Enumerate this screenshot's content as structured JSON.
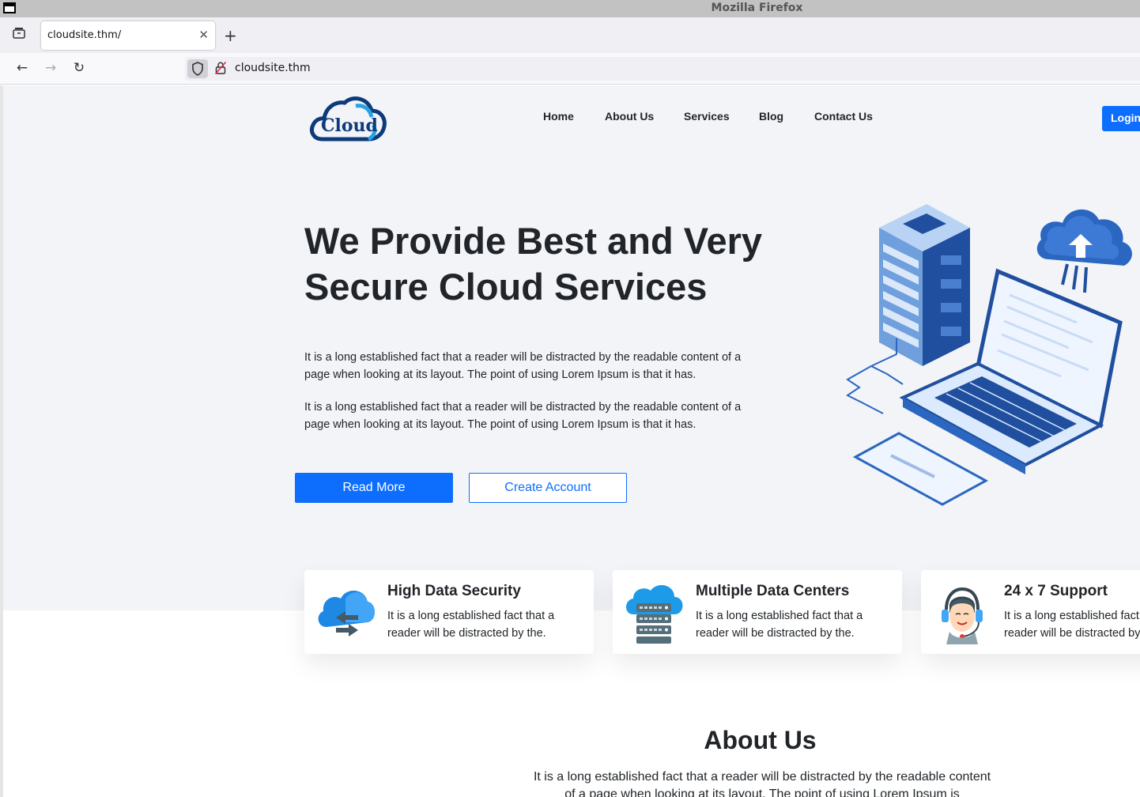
{
  "browser": {
    "window_title": "Mozilla Firefox",
    "tab_title": "cloudsite.thm/",
    "url": "cloudsite.thm"
  },
  "site": {
    "logo_text": "Cloud",
    "nav": [
      "Home",
      "About Us",
      "Services",
      "Blog",
      "Contact Us"
    ],
    "login_label": "Login"
  },
  "hero": {
    "title_line1": "We Provide Best and Very",
    "title_line2": "Secure Cloud Services",
    "paragraph1": "It is a long established fact that a reader will be distracted by the readable content of a page when looking at its layout. The point of using Lorem Ipsum is that it has.",
    "paragraph2": "It is a long established fact that a reader will be distracted by the readable content of a page when looking at its layout. The point of using Lorem Ipsum is that it has.",
    "read_more_label": "Read More",
    "create_account_label": "Create Account"
  },
  "features": [
    {
      "title": "High Data Security",
      "description": "It is a long established fact that a reader will be distracted by the.",
      "icon": "cloud-transfer-icon"
    },
    {
      "title": "Multiple Data Centers",
      "description": "It is a long established fact that a reader will be distracted by the.",
      "icon": "cloud-server-icon"
    },
    {
      "title": "24 x 7 Support",
      "description": "It is a long established fact that a reader will be distracted by the.",
      "icon": "support-agent-icon"
    }
  ],
  "about": {
    "title": "About Us",
    "text": "It is a long established fact that a reader will be distracted by the readable content of a page when looking at its layout. The point of using Lorem Ipsum is"
  },
  "colors": {
    "primary": "#0d6efd",
    "hero_background": "#f2f4f8",
    "text": "#212529"
  }
}
